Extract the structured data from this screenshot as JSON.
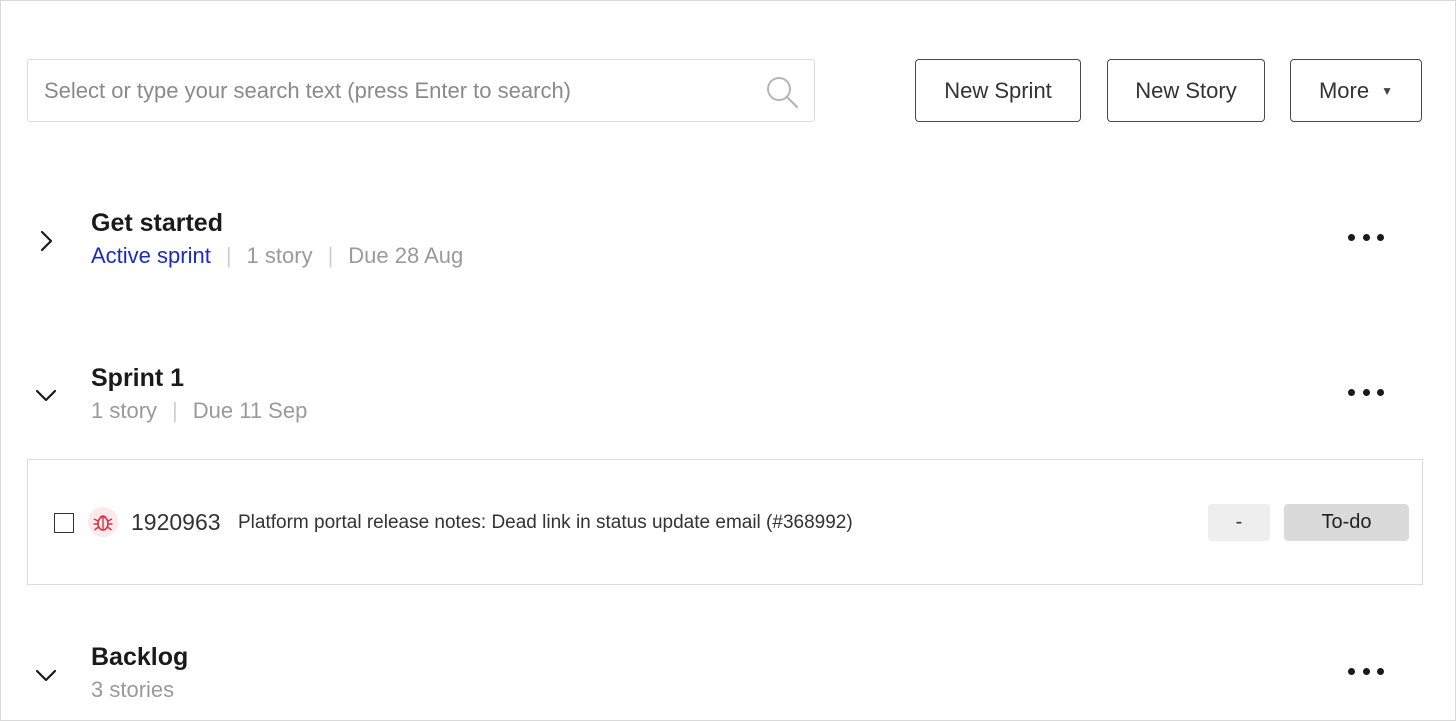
{
  "toolbar": {
    "search_placeholder": "Select or type your search text (press Enter to search)",
    "new_sprint_label": "New Sprint",
    "new_story_label": "New Story",
    "more_label": "More",
    "more_caret": "▼"
  },
  "sections": [
    {
      "title": "Get started",
      "state": "collapsed",
      "status": "Active sprint",
      "story_count": "1 story",
      "due": "Due 28 Aug"
    },
    {
      "title": "Sprint 1",
      "state": "expanded",
      "story_count": "1 story",
      "due": "Due 11 Sep",
      "stories": [
        {
          "type_icon": "bug-icon",
          "id": "1920963",
          "title": "Platform portal release notes: Dead link in status update email (#368992)",
          "points": "-",
          "status": "To-do"
        }
      ]
    },
    {
      "title": "Backlog",
      "state": "expanded",
      "story_count": "3 stories"
    }
  ],
  "colors": {
    "active_link": "#1a2bc0",
    "meta_gray": "#9a9a9a",
    "bug_red": "#d4364a",
    "status_pill": "#dadada"
  }
}
